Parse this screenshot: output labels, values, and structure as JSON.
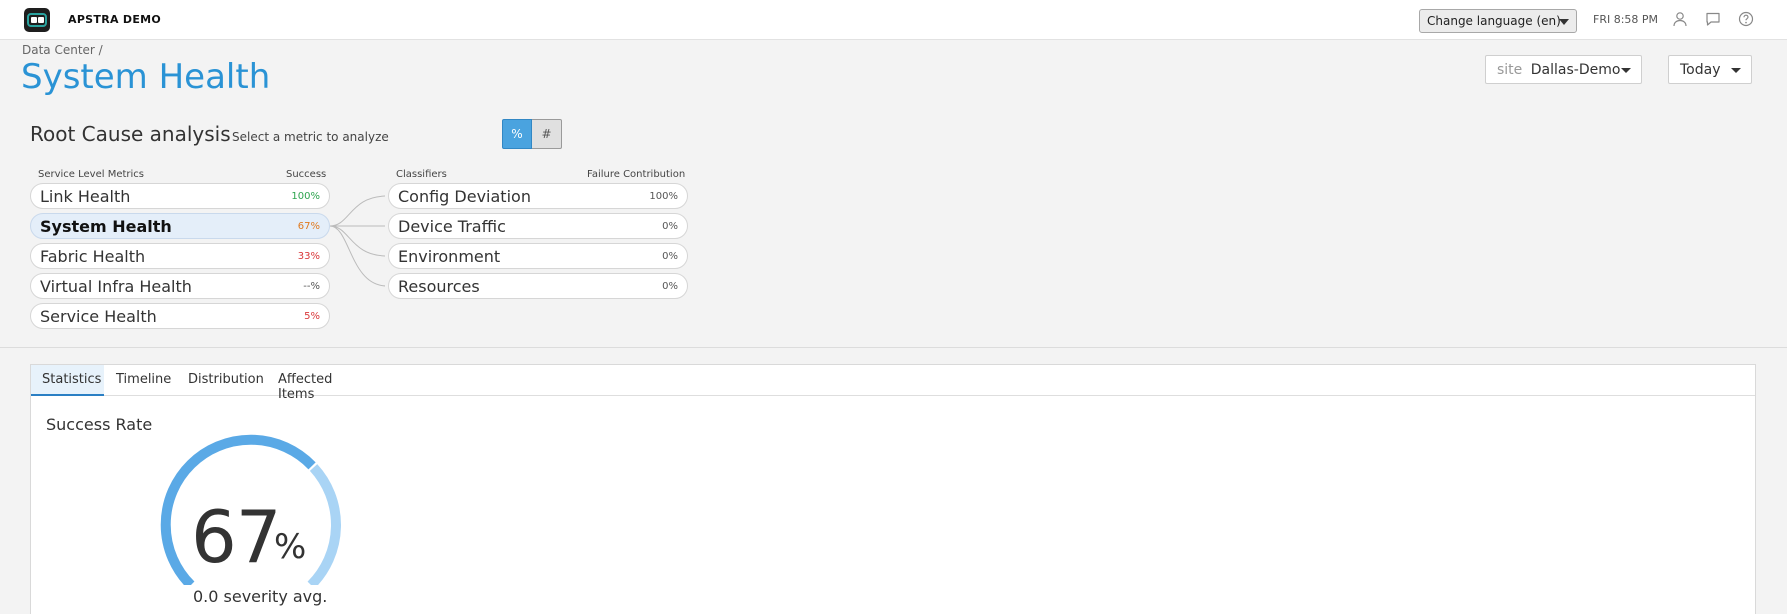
{
  "app": {
    "brand": "APSTRA DEMO"
  },
  "topbar": {
    "language_label": "Change language (en)",
    "clock": "FRI 8:58 PM",
    "icons": [
      "user-icon",
      "chat-icon",
      "help-icon"
    ]
  },
  "header": {
    "breadcrumb": "Data Center /",
    "title": "System Health",
    "site_label": "site",
    "site_value": "Dallas-Demo",
    "range_value": "Today"
  },
  "rca": {
    "title": "Root Cause analysis",
    "subtitle": "Select a metric to analyze",
    "toggle_percent": "%",
    "toggle_count": "#",
    "metrics_header": "Service Level Metrics",
    "success_header": "Success",
    "classifiers_header": "Classifiers",
    "failure_header": "Failure Contribution",
    "metrics": [
      {
        "name": "Link Health",
        "value": "100%"
      },
      {
        "name": "System Health",
        "value": "67%"
      },
      {
        "name": "Fabric Health",
        "value": "33%"
      },
      {
        "name": "Virtual Infra Health",
        "value": "--%"
      },
      {
        "name": "Service Health",
        "value": "5%"
      }
    ],
    "classifiers": [
      {
        "name": "Config Deviation",
        "value": "100%"
      },
      {
        "name": "Device Traffic",
        "value": "0%"
      },
      {
        "name": "Environment",
        "value": "0%"
      },
      {
        "name": "Resources",
        "value": "0%"
      }
    ]
  },
  "tabs": [
    {
      "label": "Statistics"
    },
    {
      "label": "Timeline"
    },
    {
      "label": "Distribution"
    },
    {
      "label": "Affected Items"
    }
  ],
  "stats": {
    "title": "Success Rate",
    "value": "67",
    "unit": "%",
    "fraction": 0.67,
    "subtitle": "0.0 severity avg."
  },
  "colors": {
    "accent": "#2a93d5",
    "gauge_filled": "#5aa9e6",
    "gauge_rest": "#a9d4f5",
    "success_green": "#2ea44f",
    "warn_orange": "#e07a1f",
    "fail_red": "#d9383a"
  }
}
